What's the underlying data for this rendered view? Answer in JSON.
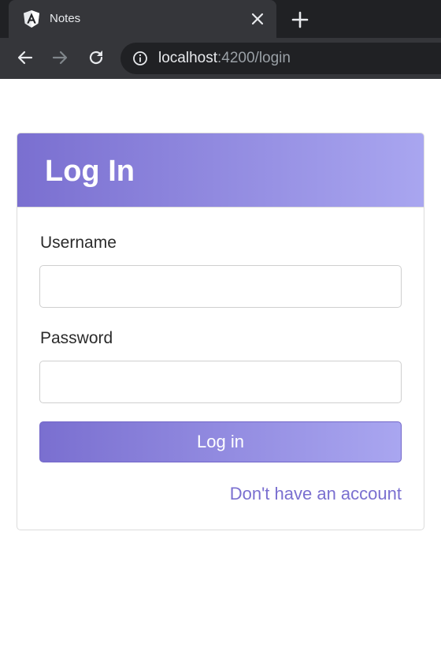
{
  "browser": {
    "tab": {
      "title": "Notes",
      "favicon": "angular-logo-icon"
    },
    "address_bar": {
      "host": "localhost",
      "path": ":4200/login"
    }
  },
  "login_card": {
    "title": "Log In",
    "username": {
      "label": "Username",
      "value": "",
      "placeholder": ""
    },
    "password": {
      "label": "Password",
      "value": "",
      "placeholder": ""
    },
    "submit_label": "Log in",
    "signup_link": "Don't have an account"
  },
  "colors": {
    "accent_start": "#7a6fd0",
    "accent_end": "#a9a6f0",
    "link": "#7a6fd0",
    "chrome_dark": "#202124",
    "chrome_tab": "#35363a"
  }
}
